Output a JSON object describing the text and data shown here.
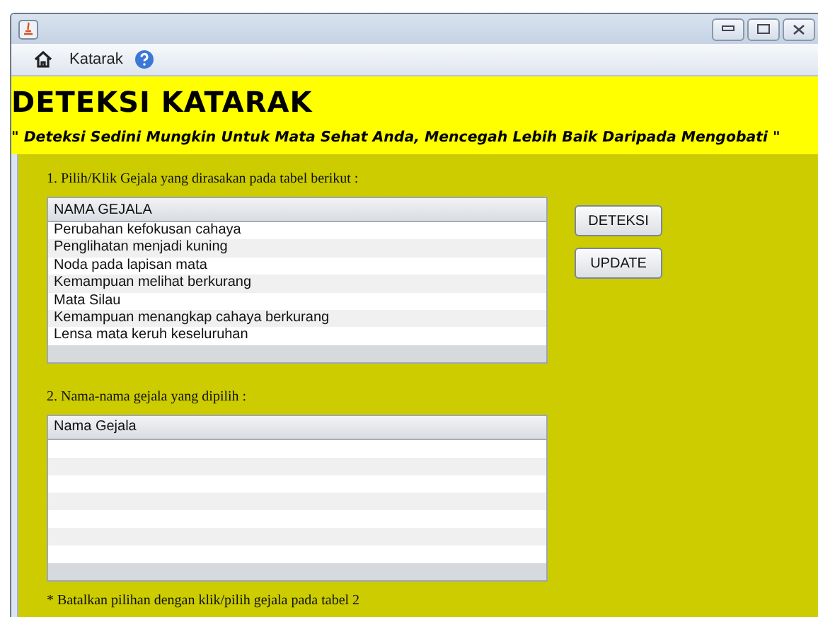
{
  "toolbar": {
    "label": "Katarak"
  },
  "header": {
    "title": "DETEKSI KATARAK",
    "slogan": "\" Deteksi Sedini Mungkin Untuk Mata Sehat Anda, Mencegah Lebih Baik Daripada Mengobati \""
  },
  "step_1": {
    "label": "1. Pilih/Klik Gejala yang dirasakan pada tabel berikut :",
    "table": {
      "columns": [
        "NAMA GEJALA"
      ],
      "rows": [
        "Perubahan kefokusan cahaya",
        "Penglihatan menjadi kuning",
        "Noda pada lapisan mata",
        "Kemampuan melihat berkurang",
        "Mata Silau",
        "Kemampuan menangkap cahaya berkurang",
        "Lensa mata keruh keseluruhan"
      ]
    }
  },
  "buttons": [
    "DETEKSI",
    "UPDATE"
  ],
  "step_2": {
    "label": "2. Nama-nama gejala yang dipilih :",
    "table": {
      "columns": [
        "Nama Gejala"
      ]
    }
  },
  "note": "* Batalkan pilihan dengan klik/pilih gejala pada tabel 2"
}
